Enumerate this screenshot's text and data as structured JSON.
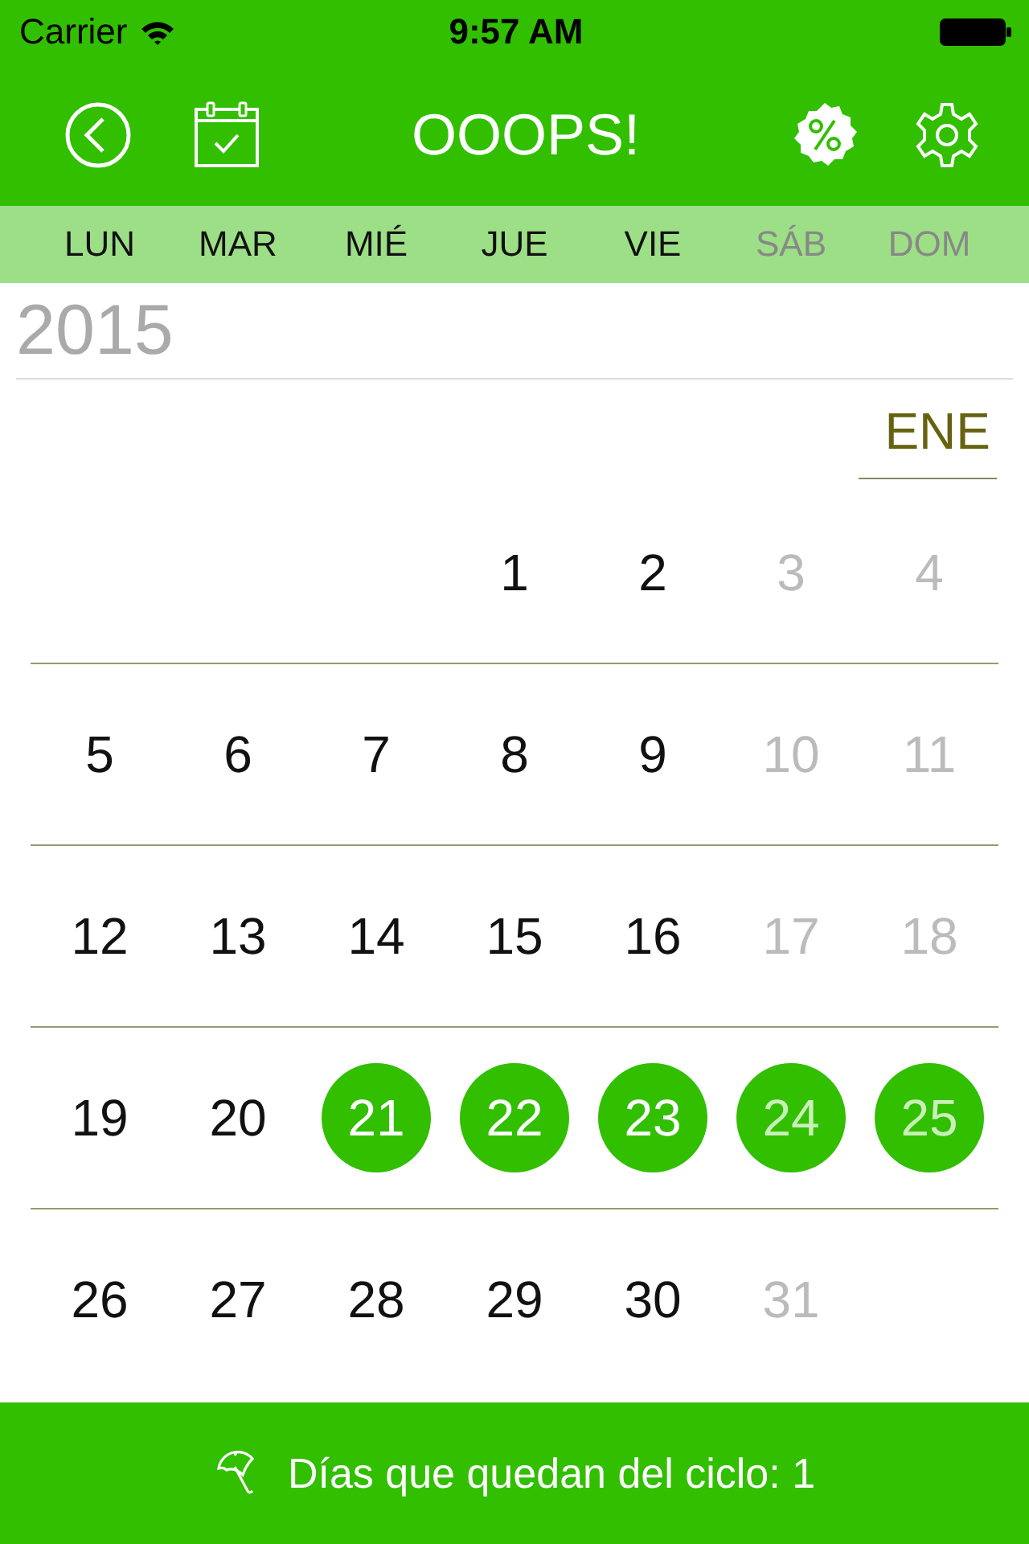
{
  "status_bar": {
    "carrier": "Carrier",
    "time": "9:57 AM"
  },
  "nav": {
    "title": "OOOPS!"
  },
  "weekdays": [
    {
      "label": "LUN",
      "weekend": false
    },
    {
      "label": "MAR",
      "weekend": false
    },
    {
      "label": "MIÉ",
      "weekend": false
    },
    {
      "label": "JUE",
      "weekend": false
    },
    {
      "label": "VIE",
      "weekend": false
    },
    {
      "label": "SÁB",
      "weekend": true
    },
    {
      "label": "DOM",
      "weekend": true
    }
  ],
  "year": "2015",
  "month": "ENE",
  "weeks": [
    [
      {
        "blank": true
      },
      {
        "blank": true
      },
      {
        "blank": true
      },
      {
        "label": "1",
        "weekend": false,
        "marked": false
      },
      {
        "label": "2",
        "weekend": false,
        "marked": false
      },
      {
        "label": "3",
        "weekend": true,
        "marked": false
      },
      {
        "label": "4",
        "weekend": true,
        "marked": false
      }
    ],
    [
      {
        "label": "5",
        "weekend": false,
        "marked": false
      },
      {
        "label": "6",
        "weekend": false,
        "marked": false
      },
      {
        "label": "7",
        "weekend": false,
        "marked": false
      },
      {
        "label": "8",
        "weekend": false,
        "marked": false
      },
      {
        "label": "9",
        "weekend": false,
        "marked": false
      },
      {
        "label": "10",
        "weekend": true,
        "marked": false
      },
      {
        "label": "11",
        "weekend": true,
        "marked": false
      }
    ],
    [
      {
        "label": "12",
        "weekend": false,
        "marked": false
      },
      {
        "label": "13",
        "weekend": false,
        "marked": false
      },
      {
        "label": "14",
        "weekend": false,
        "marked": false
      },
      {
        "label": "15",
        "weekend": false,
        "marked": false
      },
      {
        "label": "16",
        "weekend": false,
        "marked": false
      },
      {
        "label": "17",
        "weekend": true,
        "marked": false
      },
      {
        "label": "18",
        "weekend": true,
        "marked": false
      }
    ],
    [
      {
        "label": "19",
        "weekend": false,
        "marked": false
      },
      {
        "label": "20",
        "weekend": false,
        "marked": false
      },
      {
        "label": "21",
        "weekend": false,
        "marked": true
      },
      {
        "label": "22",
        "weekend": false,
        "marked": true
      },
      {
        "label": "23",
        "weekend": false,
        "marked": true
      },
      {
        "label": "24",
        "weekend": true,
        "marked": true
      },
      {
        "label": "25",
        "weekend": true,
        "marked": true
      }
    ],
    [
      {
        "label": "26",
        "weekend": false,
        "marked": false
      },
      {
        "label": "27",
        "weekend": false,
        "marked": false
      },
      {
        "label": "28",
        "weekend": false,
        "marked": false
      },
      {
        "label": "29",
        "weekend": false,
        "marked": false
      },
      {
        "label": "30",
        "weekend": false,
        "marked": false
      },
      {
        "label": "31",
        "weekend": true,
        "marked": false
      }
    ]
  ],
  "footer": {
    "text": "Días que quedan del ciclo: 1"
  }
}
